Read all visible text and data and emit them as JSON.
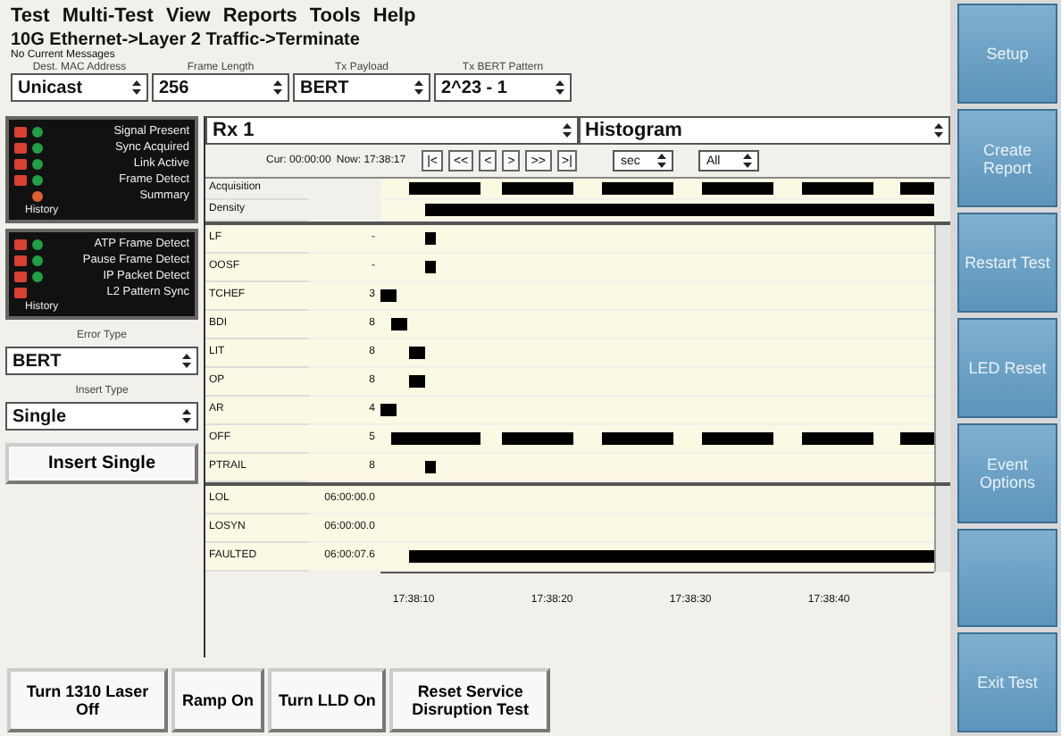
{
  "menu": [
    "Test",
    "Multi-Test",
    "View",
    "Reports",
    "Tools",
    "Help"
  ],
  "title": "10G Ethernet->Layer 2 Traffic->Terminate",
  "subtitle": "No Current Messages",
  "fields": [
    {
      "label": "Dest. MAC Address",
      "value": "Unicast"
    },
    {
      "label": "Frame Length",
      "value": "256"
    },
    {
      "label": "Tx Payload",
      "value": "BERT"
    },
    {
      "label": "Tx BERT Pattern",
      "value": "2^23 - 1"
    }
  ],
  "leds1": {
    "items": [
      {
        "label": "Signal Present",
        "history": true,
        "color": "#20a040"
      },
      {
        "label": "Sync Acquired",
        "history": true,
        "color": "#20a040"
      },
      {
        "label": "Link Active",
        "history": true,
        "color": "#20a040"
      },
      {
        "label": "Frame Detect",
        "history": true,
        "color": "#20a040"
      },
      {
        "label": "Summary",
        "history": false,
        "color": "#e06030"
      }
    ],
    "history": "History"
  },
  "leds2": {
    "items": [
      {
        "label": "ATP Frame Detect",
        "history": true,
        "color": "#20a040"
      },
      {
        "label": "Pause Frame Detect",
        "history": true,
        "color": "#20a040"
      },
      {
        "label": "IP Packet Detect",
        "history": true,
        "color": "#20a040"
      },
      {
        "label": "L2 Pattern Sync",
        "history": true
      }
    ],
    "history": "History"
  },
  "error_type": {
    "label": "Error Type",
    "value": "BERT"
  },
  "insert_type": {
    "label": "Insert Type",
    "value": "Single"
  },
  "insert_button": "Insert Single",
  "view": {
    "source": "Rx 1",
    "display": "Histogram"
  },
  "toolbar": {
    "cursor": "Cur: 00:00:00",
    "now": "Now: 17:38:17",
    "nav": [
      "|<",
      "<<",
      "<",
      ">",
      ">>",
      ">|"
    ],
    "unit": "sec",
    "range": "All"
  },
  "top_rows": [
    {
      "label": "Acquisition"
    },
    {
      "label": "Density"
    }
  ],
  "rows": [
    {
      "label": "LF",
      "count": "-"
    },
    {
      "label": "OOSF",
      "count": "-"
    },
    {
      "label": "TCHEF",
      "count": "3"
    },
    {
      "label": "BDI",
      "count": "8"
    },
    {
      "label": "LIT",
      "count": "8"
    },
    {
      "label": "OP",
      "count": "8"
    },
    {
      "label": "AR",
      "count": "4"
    },
    {
      "label": "OFF",
      "count": "5"
    },
    {
      "label": "PTRAIL",
      "count": "8"
    }
  ],
  "rows2": [
    {
      "label": "LOL",
      "count": "06:00:00.0"
    },
    {
      "label": "LOSYN",
      "count": "06:00:00.0"
    },
    {
      "label": "FAULTED",
      "count": "06:00:07.6"
    }
  ],
  "axis": [
    "17:38:10",
    "17:38:20",
    "17:38:30",
    "17:38:40"
  ],
  "bottom_buttons": [
    "Turn 1310 Laser Off",
    "Ramp On",
    "Turn LLD On",
    "Reset Service Disruption Test"
  ],
  "side_buttons": [
    {
      "kind": "labeled",
      "label": "Setup"
    },
    {
      "kind": "labeled",
      "label": "Create Report"
    },
    {
      "kind": "labeled",
      "label": "Restart Test"
    },
    {
      "kind": "labeled",
      "label": "LED Reset"
    },
    {
      "kind": "labeled",
      "label": "Event Options"
    },
    {
      "kind": "blank"
    },
    {
      "kind": "labeled",
      "label": "Exit Test"
    }
  ]
}
